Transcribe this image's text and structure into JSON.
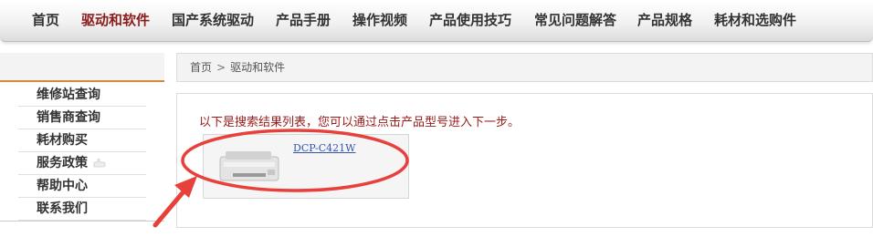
{
  "nav": {
    "items": [
      {
        "label": "首页"
      },
      {
        "label": "驱动和软件"
      },
      {
        "label": "国产系统驱动"
      },
      {
        "label": "产品手册"
      },
      {
        "label": "操作视频"
      },
      {
        "label": "产品使用技巧"
      },
      {
        "label": "常见问题解答"
      },
      {
        "label": "产品规格"
      },
      {
        "label": "耗材和选购件"
      }
    ],
    "active_index": 1,
    "active_color": "#8a1b1b"
  },
  "sidebar": {
    "items": [
      {
        "label": "维修站查询"
      },
      {
        "label": "销售商查询"
      },
      {
        "label": "耗材购买"
      },
      {
        "label": "服务政策",
        "icon": "hand-pointer-icon"
      },
      {
        "label": "帮助中心"
      },
      {
        "label": "联系我们"
      }
    ],
    "accent_color": "#d88a3a"
  },
  "breadcrumb": {
    "home": "首页",
    "separator": ">",
    "current": "驱动和软件"
  },
  "results": {
    "message": "以下是搜索结果列表，您可以通过点击产品型号进入下一步。",
    "message_color": "#9a1a1a",
    "products": [
      {
        "model": "DCP-C421W",
        "image": "printer-icon"
      }
    ]
  },
  "annotations": {
    "highlight_color": "#e8403a",
    "shapes": [
      "ellipse-highlight",
      "arrow"
    ]
  }
}
